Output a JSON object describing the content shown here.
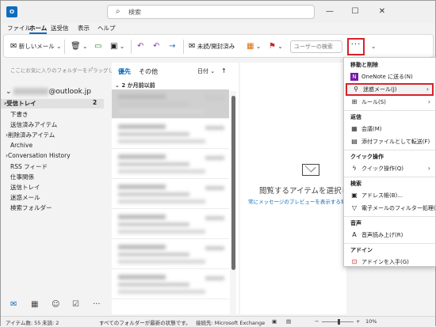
{
  "titlebar": {
    "app_icon": "O",
    "search_placeholder": "検索",
    "minimize": "—",
    "maximize": "☐",
    "close": "✕"
  },
  "menu": [
    "ファイル",
    "ホーム",
    "送受信",
    "表示",
    "ヘルプ"
  ],
  "ribbon": {
    "new_mail": "新しいメール",
    "unread_read": "未読/開封済み",
    "user_search_placeholder": "ユーザーの検索",
    "more_label": "···"
  },
  "folders": {
    "favorites_hint": "ここにお気に入りのフォルダーをドラッグします",
    "account_suffix": "@outlook.jp",
    "items": [
      {
        "label": "受信トレイ",
        "count": "2",
        "selected": true,
        "expand": true
      },
      {
        "label": "下書き"
      },
      {
        "label": "送信済みアイテム"
      },
      {
        "label": "削除済みアイテム",
        "expand": true
      },
      {
        "label": "Archive"
      },
      {
        "label": "Conversation History",
        "expand": true
      },
      {
        "label": "RSS フィード"
      },
      {
        "label": "仕事関係"
      },
      {
        "label": "送信トレイ"
      },
      {
        "label": "迷惑メール"
      },
      {
        "label": "検索フォルダー"
      }
    ]
  },
  "message_list": {
    "tabs": [
      "優先",
      "その他"
    ],
    "sort_label": "日付",
    "sort_dir": "↑",
    "group_header": "2 か月前以前",
    "message_count": 7
  },
  "reading_pane": {
    "empty_title": "閲覧するアイテムを選択してく",
    "empty_link": "常にメッセージのプレビューを表示する場合はこ"
  },
  "dropdown": {
    "sections": [
      {
        "title": "移動と削除",
        "items": [
          {
            "icon": "onenote-icon",
            "glyph": "N",
            "label": "OneNote に送る(N)"
          },
          {
            "icon": "junk-icon",
            "glyph": "⚲",
            "label": "迷惑メール(J)",
            "submenu": true,
            "highlight": true
          },
          {
            "icon": "rules-icon",
            "glyph": "⊞",
            "label": "ルール(S)",
            "submenu": true
          }
        ]
      },
      {
        "title": "返信",
        "items": [
          {
            "icon": "meeting-icon",
            "glyph": "▦",
            "label": "会議(M)"
          },
          {
            "icon": "attach-forward-icon",
            "glyph": "▤",
            "label": "添付ファイルとして転送(F)"
          }
        ]
      },
      {
        "title": "クイック操作",
        "items": [
          {
            "icon": "quick-steps-icon",
            "glyph": "ϟ",
            "label": "クイック操作(Q)",
            "submenu": true
          }
        ]
      },
      {
        "title": "検索",
        "items": [
          {
            "icon": "address-book-icon",
            "glyph": "▣",
            "label": "アドレス帳(B)..."
          },
          {
            "icon": "filter-icon",
            "glyph": "▽",
            "label": "電子メールのフィルター処理(F)",
            "submenu": true
          }
        ]
      },
      {
        "title": "音声",
        "items": [
          {
            "icon": "read-aloud-icon",
            "glyph": "A",
            "label": "音声読み上げ(R)"
          }
        ]
      },
      {
        "title": "アドイン",
        "items": [
          {
            "icon": "addins-icon",
            "glyph": "⊡",
            "label": "アドインを入手(G)"
          }
        ]
      }
    ]
  },
  "status": {
    "items": "アイテム数: 55",
    "unread": "未読: 2",
    "sync": "すべてのフォルダーが最新の状態です。",
    "connection": "接続先: Microsoft Exchange",
    "zoom": "10%"
  },
  "colors": {
    "accent": "#0f6cbd",
    "highlight_box": "#d6232b"
  }
}
